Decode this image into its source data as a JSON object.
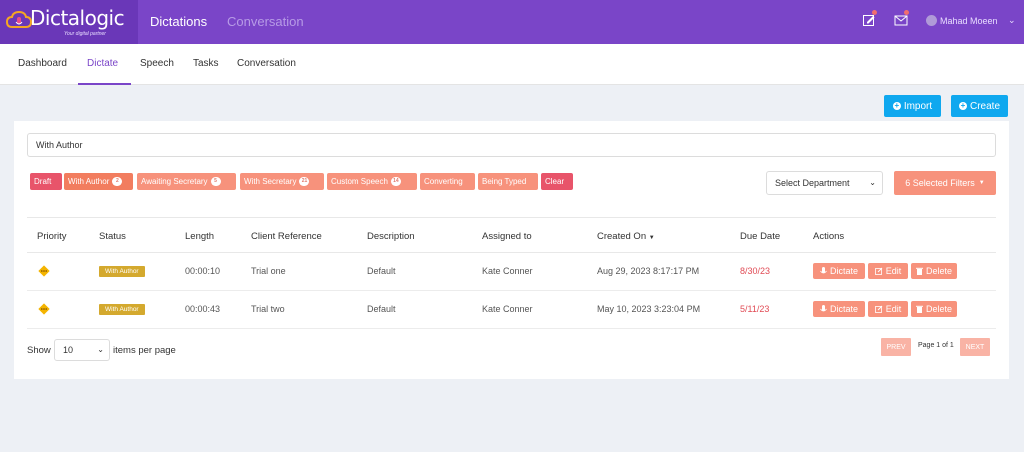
{
  "brand": {
    "name": "Dictalogic",
    "tagline": "Your digital partner"
  },
  "topnav": {
    "items": [
      "Dictations",
      "Conversation"
    ]
  },
  "user": {
    "name": "Mahad Moeen"
  },
  "subnav": {
    "items": [
      "Dashboard",
      "Dictate",
      "Speech",
      "Tasks",
      "Conversation"
    ],
    "active": "Dictate"
  },
  "actions": {
    "import_label": "Import",
    "create_label": "Create"
  },
  "search": {
    "value": "With Author"
  },
  "chips": [
    {
      "label": "Draft",
      "badge": ""
    },
    {
      "label": "With Author",
      "badge": "2"
    },
    {
      "label": "Awaiting Secretary",
      "badge": "5"
    },
    {
      "label": "With Secretary",
      "badge": "21"
    },
    {
      "label": "Custom Speech",
      "badge": "14"
    },
    {
      "label": "Converting",
      "badge": ""
    },
    {
      "label": "Being Typed",
      "badge": ""
    },
    {
      "label": "Clear",
      "badge": ""
    }
  ],
  "department": {
    "placeholder": "Select Department"
  },
  "filters": {
    "label": "6 Selected Filters"
  },
  "table": {
    "headers": [
      "Priority",
      "Status",
      "Length",
      "Client Reference",
      "Description",
      "Assigned to",
      "Created On",
      "Due Date",
      "Actions"
    ],
    "rows": [
      {
        "status": "With Author",
        "length": "00:00:10",
        "client_reference": "Trial one",
        "description": "Default",
        "assigned_to": "Kate Conner",
        "created_on": "Aug 29, 2023 8:17:17 PM",
        "due_date": "8/30/23"
      },
      {
        "status": "With Author",
        "length": "00:00:43",
        "client_reference": "Trial two",
        "description": "Default",
        "assigned_to": "Kate Conner",
        "created_on": "May 10, 2023 3:23:04 PM",
        "due_date": "5/11/23"
      }
    ],
    "row_actions": {
      "dictate": "Dictate",
      "edit": "Edit",
      "delete": "Delete"
    }
  },
  "pagination": {
    "show_label": "Show",
    "per_page": "10",
    "items_label": "items per page",
    "prev": "PREV",
    "next": "NEXT",
    "page_text": "Page 1 of 1"
  },
  "colors": {
    "brand_purple": "#7a45c8",
    "accent_blue": "#0fa8ef",
    "salmon": "#f7927c",
    "status_gold": "#d4a92e",
    "due_red": "#e14b55"
  }
}
